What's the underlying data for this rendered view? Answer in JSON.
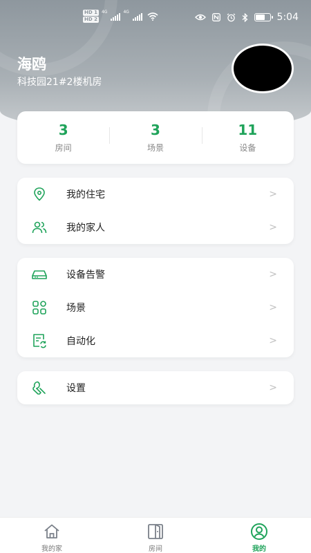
{
  "status_bar": {
    "badge_top": "HD 1",
    "badge_bottom": "HD 2",
    "network_1": "4G",
    "network_2": "4G",
    "time": "5:04",
    "battery_level": 0.6
  },
  "profile": {
    "name": "海鸥",
    "location": "科技园21#2楼机房"
  },
  "stats": [
    {
      "value": "3",
      "label": "房间"
    },
    {
      "value": "3",
      "label": "场景"
    },
    {
      "value": "11",
      "label": "设备"
    }
  ],
  "menu_group_1": [
    {
      "label": "我的住宅",
      "icon": "location-pin-icon"
    },
    {
      "label": "我的家人",
      "icon": "people-icon"
    }
  ],
  "menu_group_2": [
    {
      "label": "设备告警",
      "icon": "device-alarm-icon"
    },
    {
      "label": "场景",
      "icon": "scene-grid-icon"
    },
    {
      "label": "自动化",
      "icon": "automation-icon"
    }
  ],
  "menu_group_3": [
    {
      "label": "设置",
      "icon": "wrench-icon"
    }
  ],
  "chevron": ">",
  "tabs": [
    {
      "label": "我的家",
      "icon": "home-icon",
      "active": false
    },
    {
      "label": "房间",
      "icon": "door-icon",
      "active": false
    },
    {
      "label": "我的",
      "icon": "user-icon",
      "active": true
    }
  ],
  "colors": {
    "accent": "#1fa35a",
    "header": "#9aa2a8",
    "background": "#f3f4f6"
  }
}
